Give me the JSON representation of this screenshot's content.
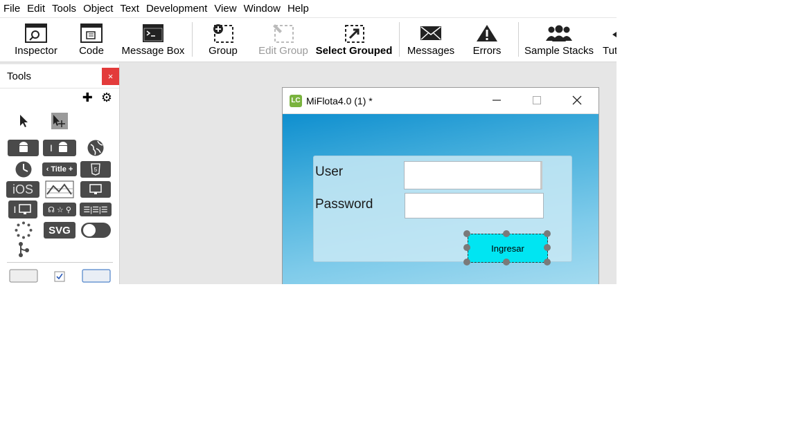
{
  "menu": [
    "File",
    "Edit",
    "Tools",
    "Object",
    "Text",
    "Development",
    "View",
    "Window",
    "Help"
  ],
  "toolbar": {
    "inspector": "Inspector",
    "code": "Code",
    "message_box": "Message Box",
    "group": "Group",
    "edit_group": "Edit Group",
    "select_grouped": "Select Grouped",
    "messages": "Messages",
    "errors": "Errors",
    "sample_stacks": "Sample Stacks",
    "tutorials": "Tut"
  },
  "tools_palette": {
    "title": "Tools",
    "close": "×",
    "title_widget": "‹ Title +",
    "ios": "iOS",
    "svg": "SVG"
  },
  "stack_window": {
    "title": "MiFlota4.0 (1) *",
    "logo": "LC",
    "user_label": "User",
    "password_label": "Password",
    "user_value": "",
    "password_value": "",
    "button_label": "Ingresar"
  }
}
